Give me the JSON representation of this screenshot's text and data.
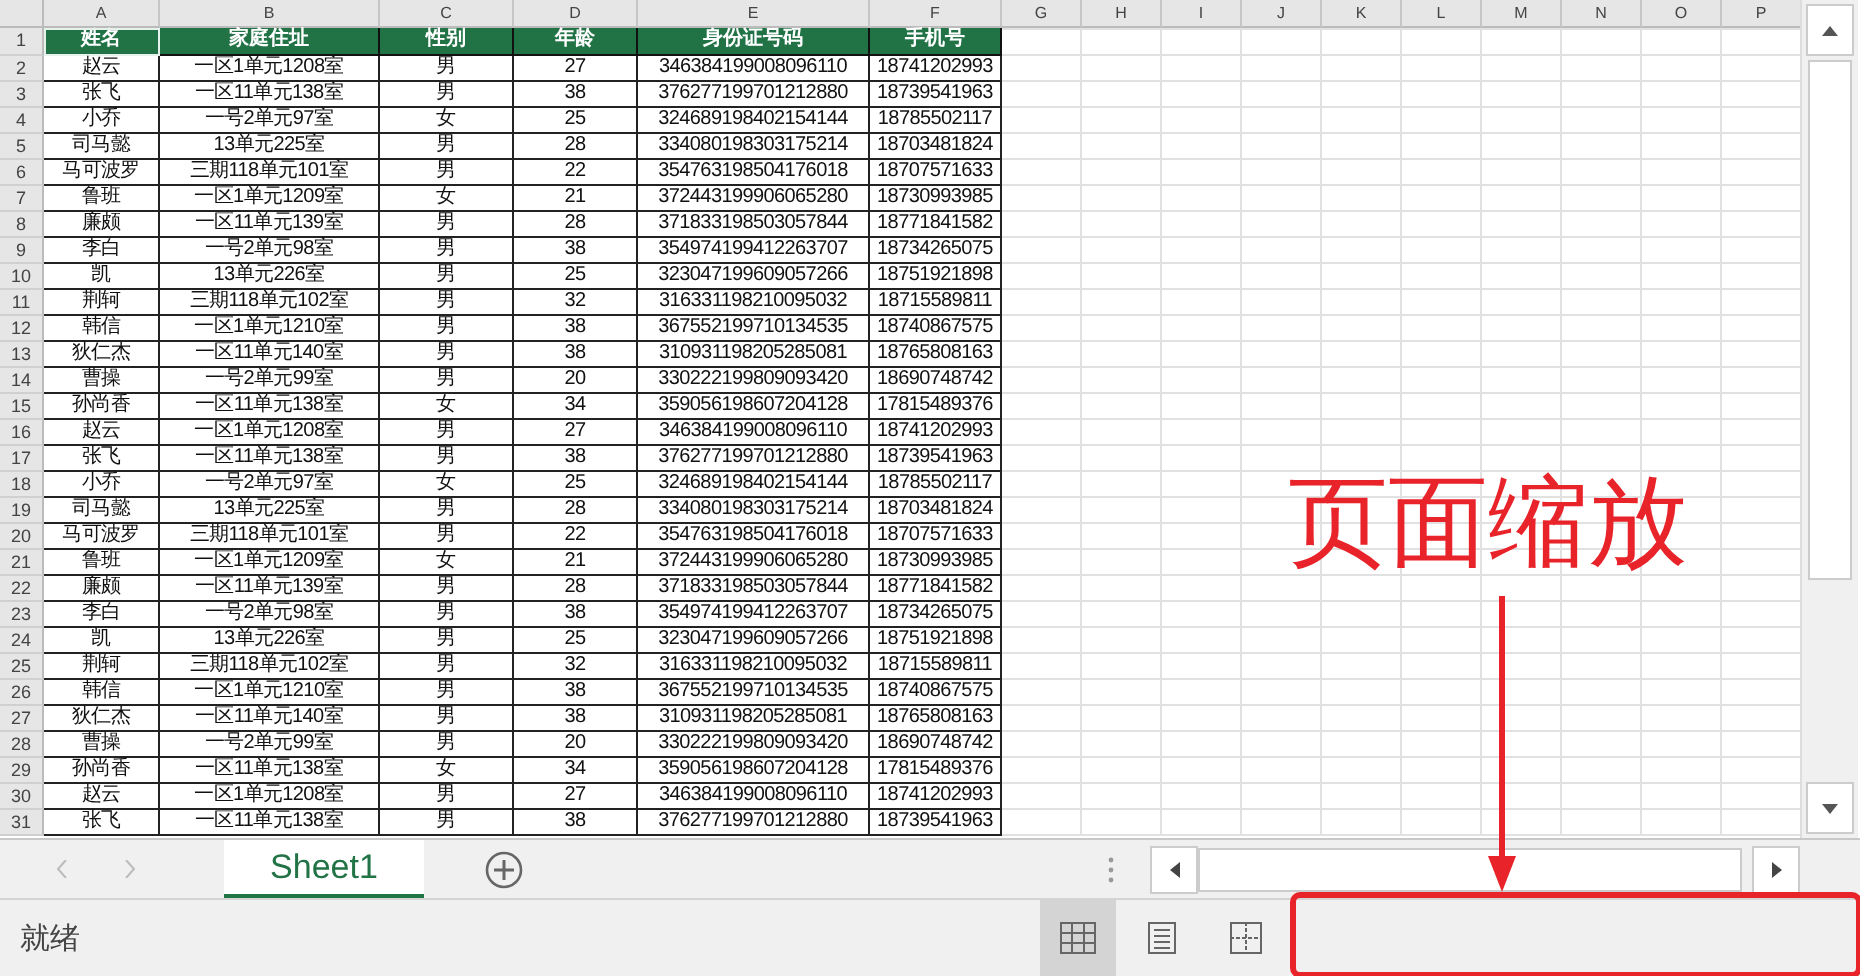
{
  "sheet": {
    "column_letters": [
      "A",
      "B",
      "C",
      "D",
      "E",
      "F",
      "G",
      "H",
      "I",
      "J",
      "K",
      "L",
      "M",
      "N",
      "O",
      "P"
    ],
    "header_row": {
      "number": "1",
      "cells": [
        {
          "text": "姓名",
          "selected": true
        },
        {
          "text": "家庭住址",
          "selected": false
        },
        {
          "text": "性别",
          "selected": false
        },
        {
          "text": "年龄",
          "selected": false
        },
        {
          "text": "身份证号码",
          "selected": false
        },
        {
          "text": "手机号",
          "selected": false
        }
      ]
    },
    "rows": [
      {
        "number": "2",
        "cells": [
          "赵云",
          "一区1单元1208室",
          "男",
          "27",
          "346384199008096110",
          "18741202993"
        ]
      },
      {
        "number": "3",
        "cells": [
          "张飞",
          "一区11单元138室",
          "男",
          "38",
          "376277199701212880",
          "18739541963"
        ]
      },
      {
        "number": "4",
        "cells": [
          "小乔",
          "一号2单元97室",
          "女",
          "25",
          "324689198402154144",
          "18785502117"
        ]
      },
      {
        "number": "5",
        "cells": [
          "司马懿",
          "13单元225室",
          "男",
          "28",
          "334080198303175214",
          "18703481824"
        ]
      },
      {
        "number": "6",
        "cells": [
          "马可波罗",
          "三期118单元101室",
          "男",
          "22",
          "354763198504176018",
          "18707571633"
        ]
      },
      {
        "number": "7",
        "cells": [
          "鲁班",
          "一区1单元1209室",
          "女",
          "21",
          "372443199906065280",
          "18730993985"
        ]
      },
      {
        "number": "8",
        "cells": [
          "廉颇",
          "一区11单元139室",
          "男",
          "28",
          "371833198503057844",
          "18771841582"
        ]
      },
      {
        "number": "9",
        "cells": [
          "李白",
          "一号2单元98室",
          "男",
          "38",
          "354974199412263707",
          "18734265075"
        ]
      },
      {
        "number": "10",
        "cells": [
          "凯",
          "13单元226室",
          "男",
          "25",
          "323047199609057266",
          "18751921898"
        ]
      },
      {
        "number": "11",
        "cells": [
          "荆轲",
          "三期118单元102室",
          "男",
          "32",
          "316331198210095032",
          "18715589811"
        ]
      },
      {
        "number": "12",
        "cells": [
          "韩信",
          "一区1单元1210室",
          "男",
          "38",
          "367552199710134535",
          "18740867575"
        ]
      },
      {
        "number": "13",
        "cells": [
          "狄仁杰",
          "一区11单元140室",
          "男",
          "38",
          "310931198205285081",
          "18765808163"
        ]
      },
      {
        "number": "14",
        "cells": [
          "曹操",
          "一号2单元99室",
          "男",
          "20",
          "330222199809093420",
          "18690748742"
        ]
      },
      {
        "number": "15",
        "cells": [
          "孙尚香",
          "一区11单元138室",
          "女",
          "34",
          "359056198607204128",
          "17815489376"
        ]
      },
      {
        "number": "16",
        "cells": [
          "赵云",
          "一区1单元1208室",
          "男",
          "27",
          "346384199008096110",
          "18741202993"
        ]
      },
      {
        "number": "17",
        "cells": [
          "张飞",
          "一区11单元138室",
          "男",
          "38",
          "376277199701212880",
          "18739541963"
        ]
      },
      {
        "number": "18",
        "cells": [
          "小乔",
          "一号2单元97室",
          "女",
          "25",
          "324689198402154144",
          "18785502117"
        ]
      },
      {
        "number": "19",
        "cells": [
          "司马懿",
          "13单元225室",
          "男",
          "28",
          "334080198303175214",
          "18703481824"
        ]
      },
      {
        "number": "20",
        "cells": [
          "马可波罗",
          "三期118单元101室",
          "男",
          "22",
          "354763198504176018",
          "18707571633"
        ]
      },
      {
        "number": "21",
        "cells": [
          "鲁班",
          "一区1单元1209室",
          "女",
          "21",
          "372443199906065280",
          "18730993985"
        ]
      },
      {
        "number": "22",
        "cells": [
          "廉颇",
          "一区11单元139室",
          "男",
          "28",
          "371833198503057844",
          "18771841582"
        ]
      },
      {
        "number": "23",
        "cells": [
          "李白",
          "一号2单元98室",
          "男",
          "38",
          "354974199412263707",
          "18734265075"
        ]
      },
      {
        "number": "24",
        "cells": [
          "凯",
          "13单元226室",
          "男",
          "25",
          "323047199609057266",
          "18751921898"
        ]
      },
      {
        "number": "25",
        "cells": [
          "荆轲",
          "三期118单元102室",
          "男",
          "32",
          "316331198210095032",
          "18715589811"
        ]
      },
      {
        "number": "26",
        "cells": [
          "韩信",
          "一区1单元1210室",
          "男",
          "38",
          "367552199710134535",
          "18740867575"
        ]
      },
      {
        "number": "27",
        "cells": [
          "狄仁杰",
          "一区11单元140室",
          "男",
          "38",
          "310931198205285081",
          "18765808163"
        ]
      },
      {
        "number": "28",
        "cells": [
          "曹操",
          "一号2单元99室",
          "男",
          "20",
          "330222199809093420",
          "18690748742"
        ]
      },
      {
        "number": "29",
        "cells": [
          "孙尚香",
          "一区11单元138室",
          "女",
          "34",
          "359056198607204128",
          "17815489376"
        ]
      },
      {
        "number": "30",
        "cells": [
          "赵云",
          "一区1单元1208室",
          "男",
          "27",
          "346384199008096110",
          "18741202993"
        ]
      },
      {
        "number": "31",
        "cells": [
          "张飞",
          "一区11单元138室",
          "男",
          "38",
          "376277199701212880",
          "18739541963"
        ]
      }
    ]
  },
  "sheet_tabs": [
    {
      "label": "Sheet1",
      "selected": true
    }
  ],
  "status_bar": {
    "text": "就绪",
    "view_buttons": [
      {
        "kind": "normal",
        "selected": true
      },
      {
        "kind": "page_layout",
        "selected": false
      },
      {
        "kind": "page_break",
        "selected": false
      }
    ]
  },
  "annotation": {
    "text": "页面缩放"
  }
}
